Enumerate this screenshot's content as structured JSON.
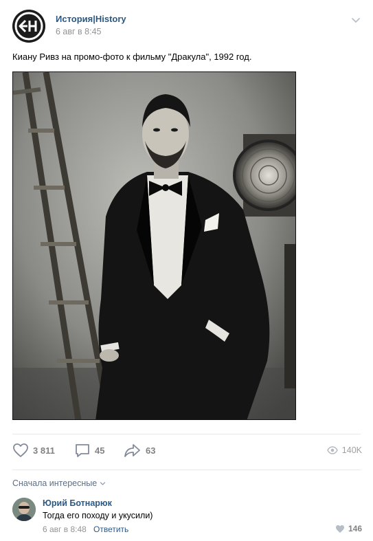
{
  "post": {
    "group_name": "История|History",
    "time": "6 авг в 8:45",
    "text": "Киану Ривз на промо-фото к фильму \"Дракула\", 1992 год."
  },
  "stats": {
    "likes": "3 811",
    "comments": "45",
    "shares": "63",
    "views": "140K"
  },
  "comments_section": {
    "sort_label": "Сначала интересные"
  },
  "comment": {
    "author": "Юрий Ботнарюк",
    "text": "Тогда его походу и укусили)",
    "time": "6 авг в 8:48",
    "reply_label": "Ответить",
    "likes": "146"
  }
}
